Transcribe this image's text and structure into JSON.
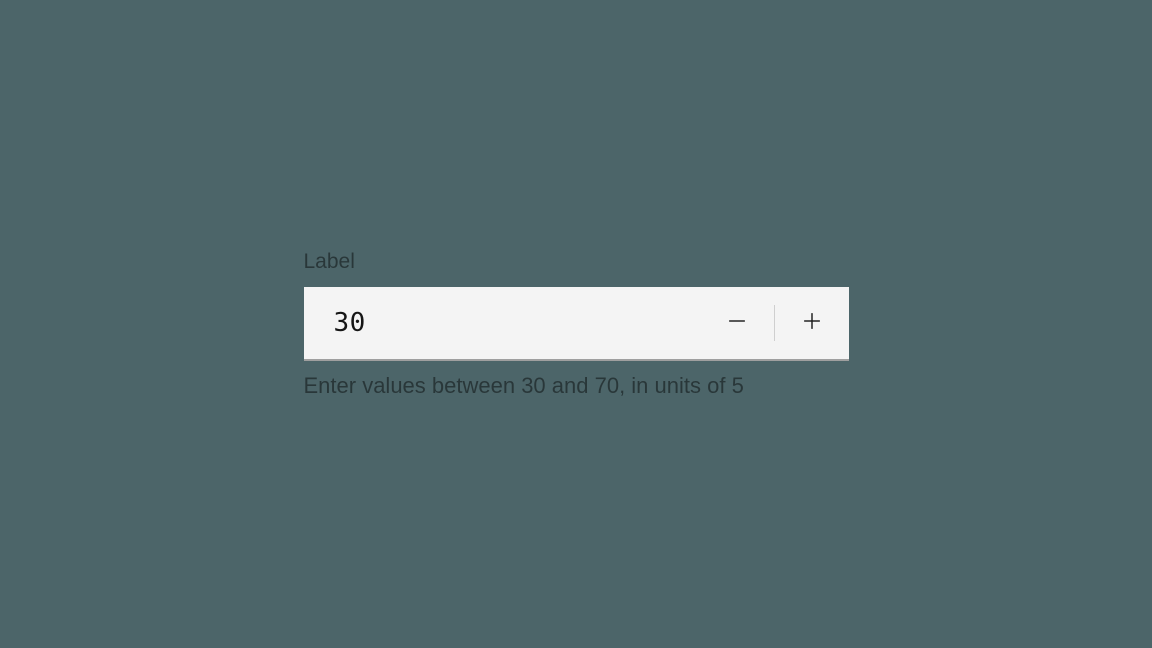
{
  "numberInput": {
    "label": "Label",
    "value": "30",
    "helperText": "Enter values between 30 and 70, in units of 5"
  }
}
